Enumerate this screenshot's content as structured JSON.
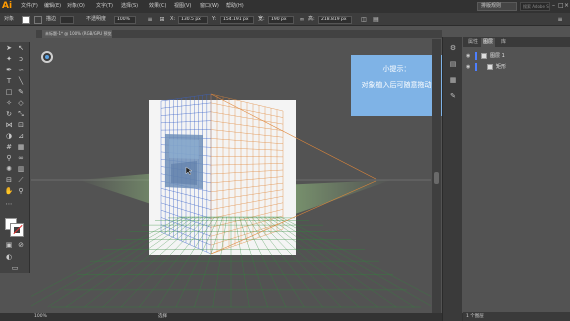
{
  "app": {
    "logo": "Ai"
  },
  "menu": {
    "items": [
      "文件(F)",
      "编辑(E)",
      "对象(O)",
      "文字(T)",
      "选择(S)",
      "效果(C)",
      "视图(V)",
      "窗口(W)",
      "帮助(H)"
    ],
    "workspace": "排版规则",
    "search_placeholder": "搜索 Adobe Stock"
  },
  "control": {
    "object_label": "对象",
    "stroke_label": "描边",
    "opacity_label": "不透明度",
    "opacity_value": "100%",
    "x_label": "X:",
    "x_value": "130.5 px",
    "y_label": "Y:",
    "y_value": "154.191 px",
    "w_label": "宽:",
    "w_value": "190 px",
    "h_label": "高:",
    "h_value": "218.819 px"
  },
  "document": {
    "tab": "未标题-1* @ 100% (RGB/GPU 预览)"
  },
  "tip": {
    "title": "小提示：",
    "text": "对象植入后可随意拖动"
  },
  "layers": {
    "tabs": [
      "属性",
      "图层",
      "库"
    ],
    "rows": [
      {
        "name": "图层 1"
      },
      {
        "name": "矩形"
      }
    ],
    "footer": "1 个图层"
  },
  "status": {
    "zoom": "100%",
    "mode": "选择"
  },
  "colors": {
    "tip_bg": "#7fb3e6",
    "left_grid": "#3a63c8",
    "right_grid": "#e0873a",
    "ground_grid": "#2e8a3a",
    "image_fill": "#6f8fb8"
  },
  "icons": {
    "tools": [
      "selection-icon",
      "direct-selection-icon",
      "magic-wand-icon",
      "lasso-icon",
      "pen-icon",
      "type-icon",
      "line-icon",
      "rectangle-icon",
      "paintbrush-icon",
      "pencil-icon",
      "eraser-icon",
      "rotate-icon",
      "scale-icon",
      "width-icon",
      "free-transform-icon",
      "shape-builder-icon",
      "perspective-grid-icon",
      "mesh-icon",
      "gradient-icon",
      "eyedropper-icon",
      "blend-icon",
      "symbol-sprayer-icon",
      "graph-icon",
      "artboard-icon",
      "slice-icon",
      "hand-icon",
      "zoom-icon"
    ]
  }
}
